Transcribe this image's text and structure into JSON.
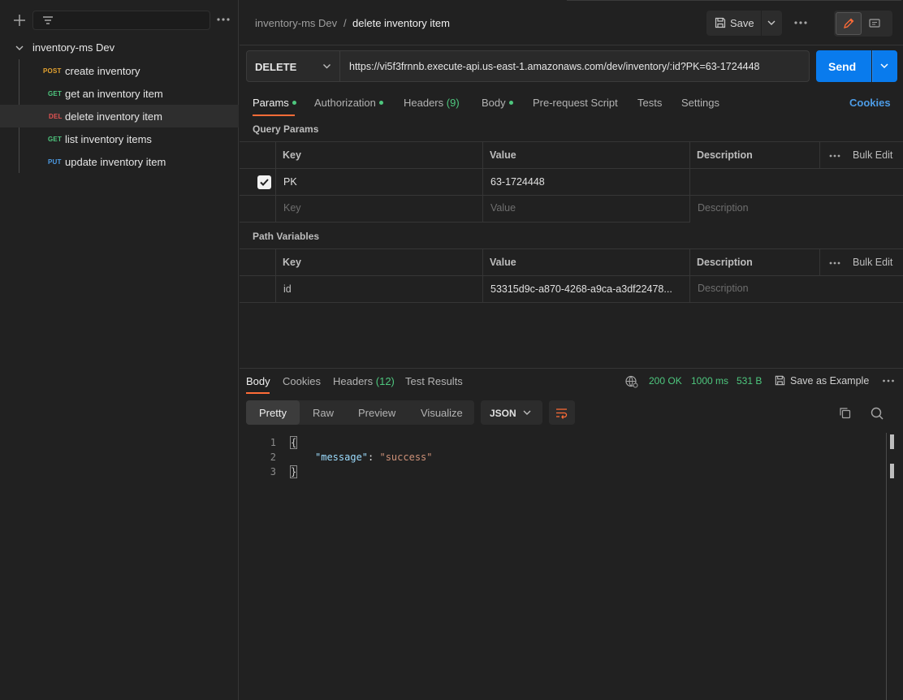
{
  "sidebar": {
    "collection_name": "inventory-ms Dev",
    "requests": [
      {
        "method": "POST",
        "name": "create inventory"
      },
      {
        "method": "GET",
        "name": "get an inventory item"
      },
      {
        "method": "DEL",
        "name": "delete inventory item",
        "selected": true
      },
      {
        "method": "GET",
        "name": "list inventory items"
      },
      {
        "method": "PUT",
        "name": "update inventory item"
      }
    ]
  },
  "header": {
    "breadcrumb_collection": "inventory-ms Dev",
    "breadcrumb_separator": "/",
    "title": "delete inventory item",
    "save_label": "Save"
  },
  "request": {
    "method": "DELETE",
    "url": "https://vi5f3frnnb.execute-api.us-east-1.amazonaws.com/dev/inventory/:id?PK=63-1724448",
    "send_label": "Send",
    "tabs": [
      {
        "label": "Params",
        "dot": true
      },
      {
        "label": "Authorization",
        "dot": true
      },
      {
        "label": "Headers",
        "count": "(9)"
      },
      {
        "label": "Body",
        "dot": true
      },
      {
        "label": "Pre-request Script"
      },
      {
        "label": "Tests"
      },
      {
        "label": "Settings"
      }
    ],
    "cookies_label": "Cookies"
  },
  "query_params": {
    "title": "Query Params",
    "headers": {
      "key": "Key",
      "value": "Value",
      "description": "Description",
      "bulk_edit": "Bulk Edit"
    },
    "rows": [
      {
        "checked": true,
        "key": "PK",
        "value": "63-1724448",
        "description": ""
      }
    ],
    "placeholders": {
      "key": "Key",
      "value": "Value",
      "description": "Description"
    }
  },
  "path_variables": {
    "title": "Path Variables",
    "headers": {
      "key": "Key",
      "value": "Value",
      "description": "Description",
      "bulk_edit": "Bulk Edit"
    },
    "rows": [
      {
        "key": "id",
        "value": "53315d9c-a870-4268-a9ca-a3df22478...",
        "description_placeholder": "Description"
      }
    ]
  },
  "response": {
    "tabs": [
      {
        "label": "Body"
      },
      {
        "label": "Cookies"
      },
      {
        "label": "Headers",
        "count": "(12)"
      },
      {
        "label": "Test Results"
      }
    ],
    "status": "200 OK",
    "time": "1000 ms",
    "size": "531 B",
    "save_example_label": "Save as Example",
    "views": [
      "Pretty",
      "Raw",
      "Preview",
      "Visualize"
    ],
    "format": "JSON",
    "code": {
      "line_numbers": [
        "1",
        "2",
        "3"
      ],
      "open_brace": "{",
      "key": "\"message\"",
      "colon": ": ",
      "value": "\"success\"",
      "close_brace": "}"
    }
  },
  "colors": {
    "accent": "#ff6c37",
    "send_button": "#097bed",
    "success": "#4ec77e",
    "method_post": "#e5a330",
    "method_get": "#4ec77e",
    "method_delete": "#e45353",
    "method_put": "#4d9ce6"
  },
  "icons": [
    "plus-icon",
    "filter-icon",
    "more-icon",
    "chevron-down-icon",
    "save-icon",
    "pencil-icon",
    "comment-icon",
    "globe-icon",
    "copy-icon",
    "search-icon",
    "wrap-icon",
    "check-icon"
  ]
}
